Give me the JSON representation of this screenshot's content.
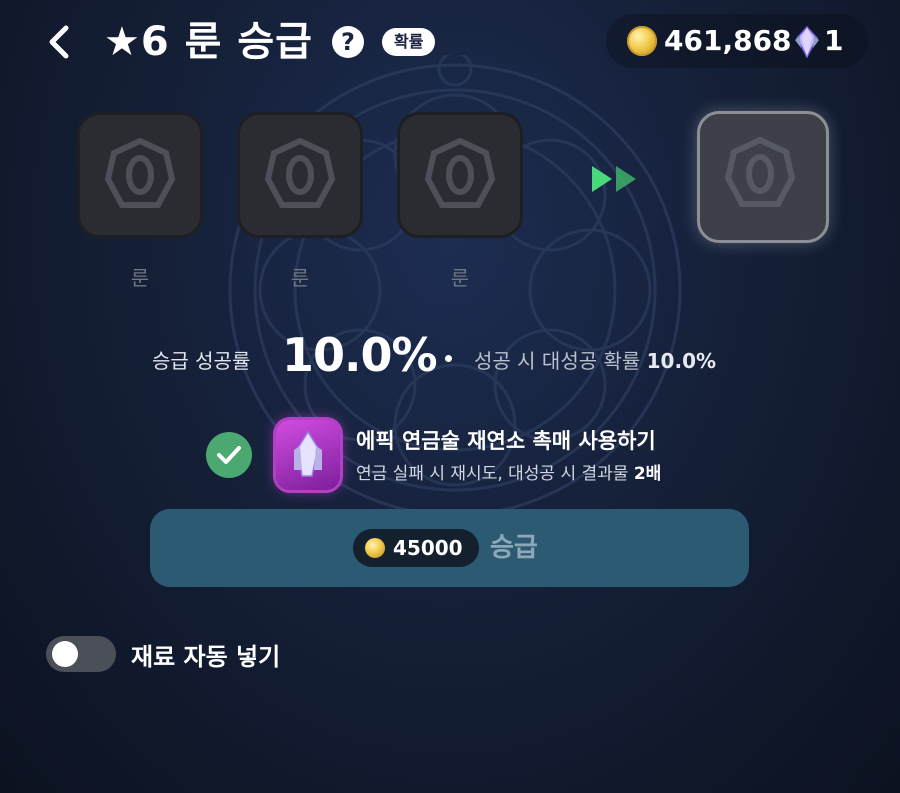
{
  "header": {
    "title": "★6 룬 승급",
    "help_symbol": "?",
    "probability_badge": "확률"
  },
  "currency": {
    "coins": "461,868",
    "gems": "1"
  },
  "slots": [
    {
      "label": "룬"
    },
    {
      "label": "룬"
    },
    {
      "label": "룬"
    }
  ],
  "rate": {
    "label": "승급 성공률",
    "value": "10.0%",
    "great_success_label": "성공 시 대성공 확률",
    "great_success_value": "10.0%"
  },
  "catalyst": {
    "checked": true,
    "title": "에픽 연금술 재연소 촉매 사용하기",
    "desc_prefix": "연금 실패 시 재시도, 대성공 시 결과물",
    "desc_value": "2배"
  },
  "upgrade": {
    "cost": "45000",
    "label": "승급"
  },
  "auto_fill": {
    "enabled": false,
    "label": "재료 자동 넣기"
  },
  "colors": {
    "accent_green": "#4aa870",
    "button_bg": "#2c5a72",
    "catalyst_purple": "#b33fc6"
  }
}
